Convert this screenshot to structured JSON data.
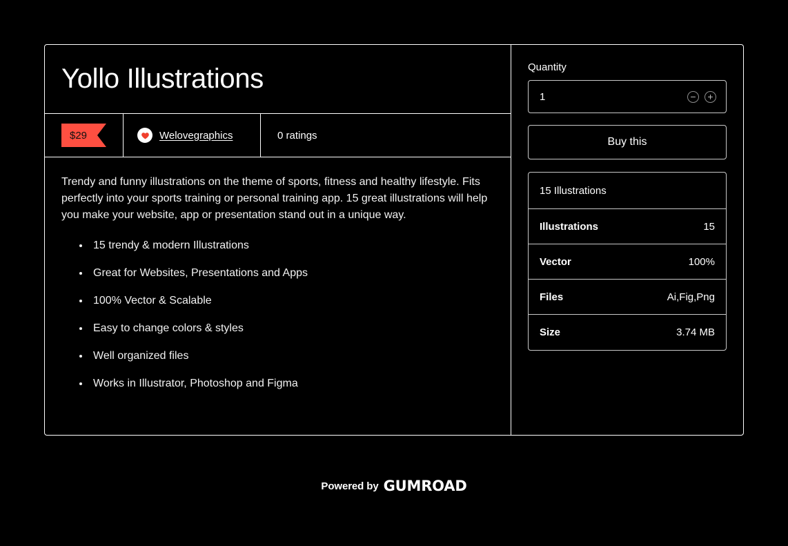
{
  "theme": {
    "background": "#000000",
    "text": "#ffffff",
    "border": "#ffffff",
    "accent": "#ff4f41",
    "muted_border": "#c9c9c9"
  },
  "product": {
    "title": "Yollo Illustrations",
    "meta": {
      "price": "$29",
      "seller_name": "Welovegraphics",
      "seller_avatar_icon": "heart-icon",
      "ratings": "0 ratings"
    },
    "description": {
      "paragraph": "Trendy and funny illustrations on the theme of sports, fitness and healthy lifestyle. Fits perfectly into your sports training or personal training app. 15 great illustrations will help you make your website, app or presentation stand out in a unique way.",
      "features": [
        "15 trendy & modern Illustrations",
        "Great for Websites, Presentations and Apps",
        "100% Vector & Scalable",
        "Easy to change colors & styles",
        "Well organized files",
        "Works in Illustrator, Photoshop and Figma"
      ]
    }
  },
  "purchase": {
    "quantity_label": "Quantity",
    "quantity_value": "1",
    "quantity_placeholder": "1",
    "decrement_icon": "minus-circle-icon",
    "increment_icon": "plus-circle-icon",
    "buy_label": "Buy this"
  },
  "details": {
    "header": "15 Illustrations",
    "rows": [
      {
        "key": "Illustrations",
        "value": "15"
      },
      {
        "key": "Vector",
        "value": "100%"
      },
      {
        "key": "Files",
        "value": "Ai,Fig,Png"
      },
      {
        "key": "Size",
        "value": "3.74 MB"
      }
    ]
  },
  "footer": {
    "powered_by": "Powered by",
    "brand": "GUMROAD"
  }
}
